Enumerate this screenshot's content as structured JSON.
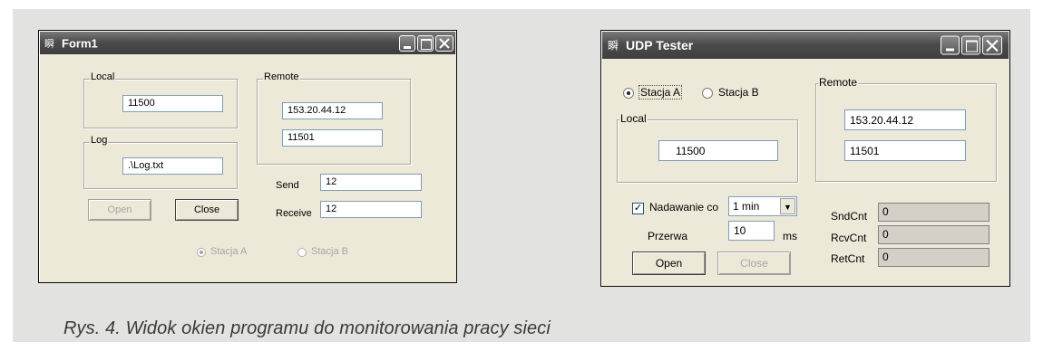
{
  "form1": {
    "title": "Form1",
    "local_label": "Local",
    "local_port": "11500",
    "remote_label": "Remote",
    "remote_ip": "153.20.44.12",
    "remote_port": "11501",
    "log_label": "Log",
    "log_file": ".\\Log.txt",
    "send_label": "Send",
    "send_value": "12",
    "receive_label": "Receive",
    "receive_value": "12",
    "open_label": "Open",
    "close_label": "Close",
    "stacja_a": "Stacja A",
    "stacja_b": "Stacja B"
  },
  "udp": {
    "title": "UDP Tester",
    "stacja_a": "Stacja A",
    "stacja_b": "Stacja B",
    "remote_label": "Remote",
    "remote_ip": "153.20.44.12",
    "remote_port": "11501",
    "local_label": "Local",
    "local_port": "11500",
    "nadawanie_label": "Nadawanie co",
    "interval_value": "1 min",
    "przerwa_label": "Przerwa",
    "przerwa_value": "10",
    "ms_label": "ms",
    "sndcnt_label": "SndCnt",
    "sndcnt_value": "0",
    "rcvcnt_label": "RcvCnt",
    "rcvcnt_value": "0",
    "retcnt_label": "RetCnt",
    "retcnt_value": "0",
    "open_label": "Open",
    "close_label": "Close"
  },
  "caption": "Rys. 4. Widok okien programu do monitorowania pracy sieci",
  "icons": {
    "app_icon": "app-icon",
    "minimize": "minimize-icon",
    "maximize": "maximize-icon",
    "close": "close-icon"
  }
}
